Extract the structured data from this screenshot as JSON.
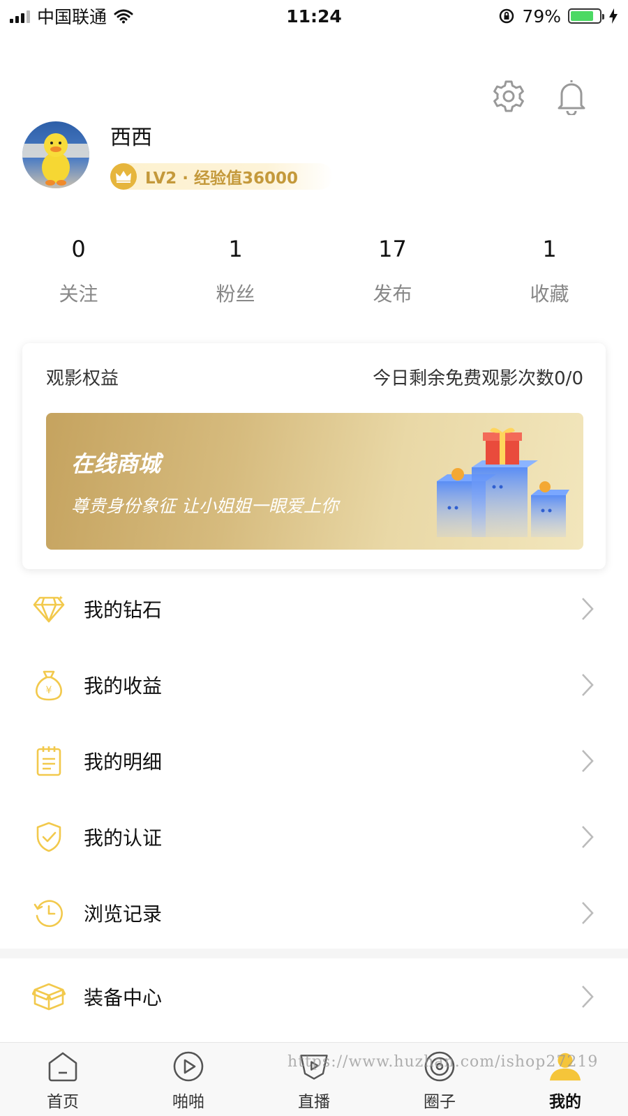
{
  "status_bar": {
    "carrier": "中国联通",
    "time": "11:24",
    "battery_percent": "79%",
    "battery_level": 0.79
  },
  "profile": {
    "username": "西西",
    "level_text": "LV2 · 经验值36000"
  },
  "stats": [
    {
      "value": "0",
      "label": "关注"
    },
    {
      "value": "1",
      "label": "粉丝"
    },
    {
      "value": "17",
      "label": "发布"
    },
    {
      "value": "1",
      "label": "收藏"
    }
  ],
  "benefit_card": {
    "title": "观影权益",
    "remaining": "今日剩余免费观影次数0/0",
    "banner_title": "在线商城",
    "banner_subtitle": "尊贵身份象征 让小姐姐一眼爱上你"
  },
  "menu": [
    {
      "label": "我的钻石",
      "icon": "diamond-icon"
    },
    {
      "label": "我的收益",
      "icon": "money-bag-icon"
    },
    {
      "label": "我的明细",
      "icon": "notepad-icon"
    },
    {
      "label": "我的认证",
      "icon": "shield-check-icon"
    },
    {
      "label": "浏览记录",
      "icon": "history-icon"
    }
  ],
  "menu_equip": {
    "label": "装备中心",
    "icon": "box-icon"
  },
  "tabs": [
    {
      "label": "首页",
      "icon": "home-icon"
    },
    {
      "label": "啪啪",
      "icon": "play-icon"
    },
    {
      "label": "直播",
      "icon": "live-icon"
    },
    {
      "label": "圈子",
      "icon": "circle-icon"
    },
    {
      "label": "我的",
      "icon": "user-icon"
    }
  ],
  "active_tab": "我的",
  "watermark": "https://www.huzhan.com/ishop27219",
  "colors": {
    "accent_gold": "#e6b53c",
    "level_text": "#c4993b",
    "icon_yellow": "#f2c94c"
  }
}
